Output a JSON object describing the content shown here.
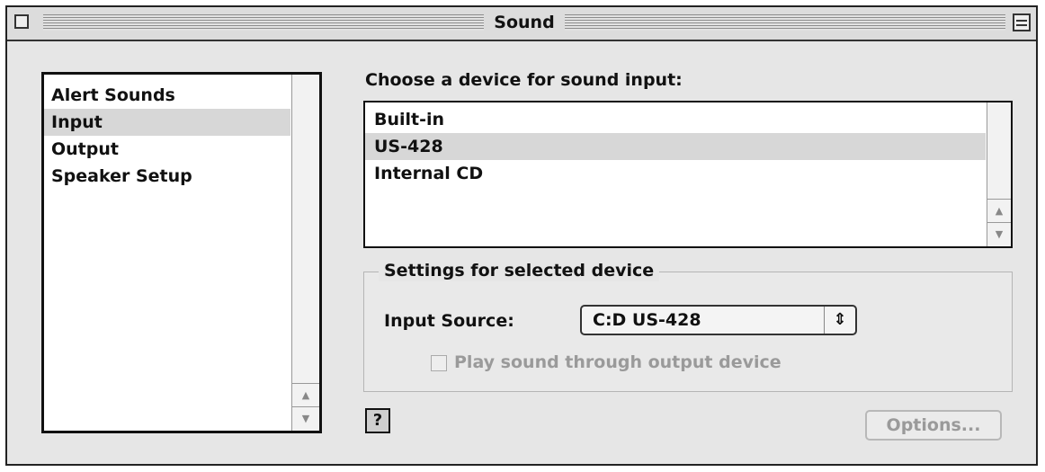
{
  "window": {
    "title": "Sound"
  },
  "sidebar": {
    "items": [
      {
        "label": "Alert Sounds",
        "selected": false
      },
      {
        "label": "Input",
        "selected": true
      },
      {
        "label": "Output",
        "selected": false
      },
      {
        "label": "Speaker Setup",
        "selected": false
      }
    ]
  },
  "device_list": {
    "heading": "Choose a device for sound input:",
    "items": [
      {
        "label": "Built-in",
        "selected": false
      },
      {
        "label": "US-428",
        "selected": true
      },
      {
        "label": "Internal CD",
        "selected": false
      }
    ]
  },
  "settings": {
    "group_title": "Settings for selected device",
    "input_source_label": "Input Source:",
    "input_source_value": "C:D US-428",
    "play_through_label": "Play sound through output device",
    "play_through_checked": false
  },
  "buttons": {
    "help_glyph": "?",
    "options_label": "Options..."
  },
  "icons": {
    "scroll_up": "▲",
    "scroll_down": "▼",
    "popup_arrows": "⇕"
  }
}
